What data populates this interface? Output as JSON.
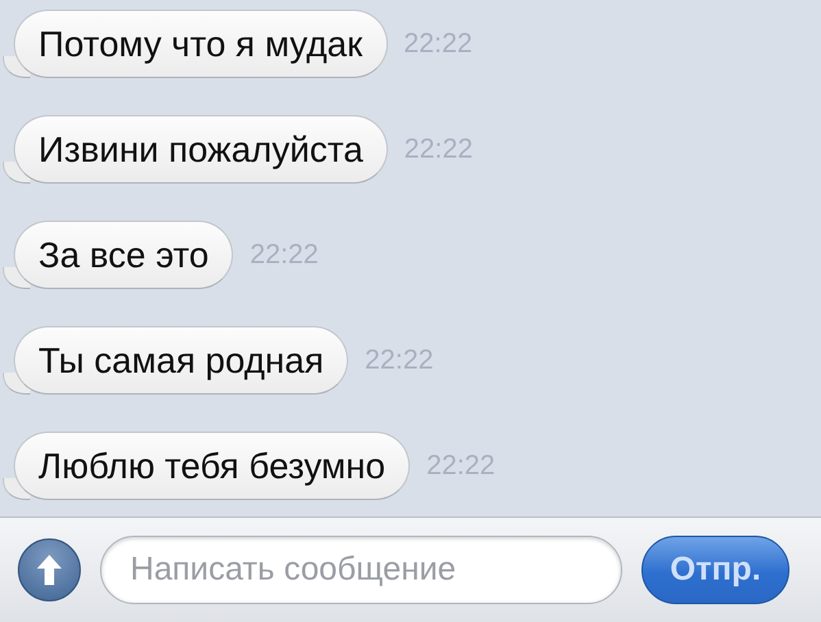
{
  "messages": [
    {
      "text": "Потому что я мудак",
      "time": "22:22"
    },
    {
      "text": "Извини пожалуйста",
      "time": "22:22"
    },
    {
      "text": "За все это",
      "time": "22:22"
    },
    {
      "text": "Ты самая родная",
      "time": "22:22"
    },
    {
      "text": "Люблю тебя безумно",
      "time": "22:22"
    }
  ],
  "composer": {
    "placeholder": "Написать сообщение",
    "send_button": "Отпр."
  }
}
